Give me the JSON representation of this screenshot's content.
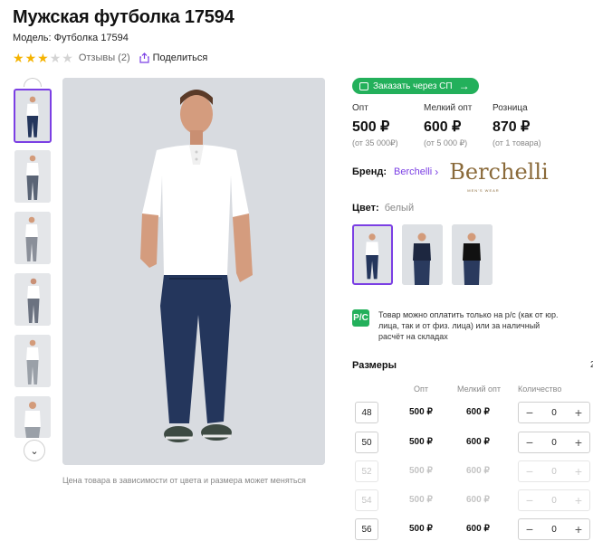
{
  "product": {
    "title": "Мужская футболка 17594",
    "model": "Модель: Футболка 17594",
    "rating": 3,
    "rating_max": 5,
    "reviews": "Отзывы (2)",
    "share": "Поделиться"
  },
  "gallery": {
    "thumbnail_count": 6,
    "active_index": 0,
    "price_note": "Цена товара в зависимости от цвета и размера может меняться"
  },
  "order_button": "Заказать через СП",
  "prices": [
    {
      "label": "Опт",
      "value": "500 ₽",
      "min": "(от 35 000₽)"
    },
    {
      "label": "Мелкий опт",
      "value": "600 ₽",
      "min": "(от 5 000 ₽)"
    },
    {
      "label": "Розница",
      "value": "870 ₽",
      "min": "(от 1 товара)"
    }
  ],
  "brand": {
    "label": "Бренд:",
    "name": "Berchelli",
    "logo_text": "Berchelli",
    "logo_sub": "MEN'S WEAR"
  },
  "color": {
    "label": "Цвет:",
    "value": "белый",
    "swatches": [
      {
        "name": "белый",
        "shirt": "#ffffff",
        "active": true
      },
      {
        "name": "тёмно-синий",
        "shirt": "#1d2740",
        "active": false
      },
      {
        "name": "чёрный",
        "shirt": "#111111",
        "active": false
      }
    ]
  },
  "payment": {
    "icon": "Р/С",
    "text": "Товар можно оплатить только на р/с (как от юр. лица, так и от физ. лица) или за наличный расчёт на складах"
  },
  "sizes": {
    "title": "Размеры",
    "side_mark": "2",
    "headers": {
      "opt": "Опт",
      "small_opt": "Мелкий опт",
      "qty": "Количество"
    },
    "rows": [
      {
        "size": "48",
        "opt": "500 ₽",
        "small_opt": "600 ₽",
        "qty": "0",
        "available": true
      },
      {
        "size": "50",
        "opt": "500 ₽",
        "small_opt": "600 ₽",
        "qty": "0",
        "available": true
      },
      {
        "size": "52",
        "opt": "500 ₽",
        "small_opt": "600 ₽",
        "qty": "0",
        "available": false
      },
      {
        "size": "54",
        "opt": "500 ₽",
        "small_opt": "600 ₽",
        "qty": "0",
        "available": false
      },
      {
        "size": "56",
        "opt": "500 ₽",
        "small_opt": "600 ₽",
        "qty": "0",
        "available": true
      }
    ]
  },
  "colors": {
    "accent": "#7b3fe4",
    "green": "#23b05b",
    "star": "#f5b301",
    "jeans": "#24365c"
  }
}
